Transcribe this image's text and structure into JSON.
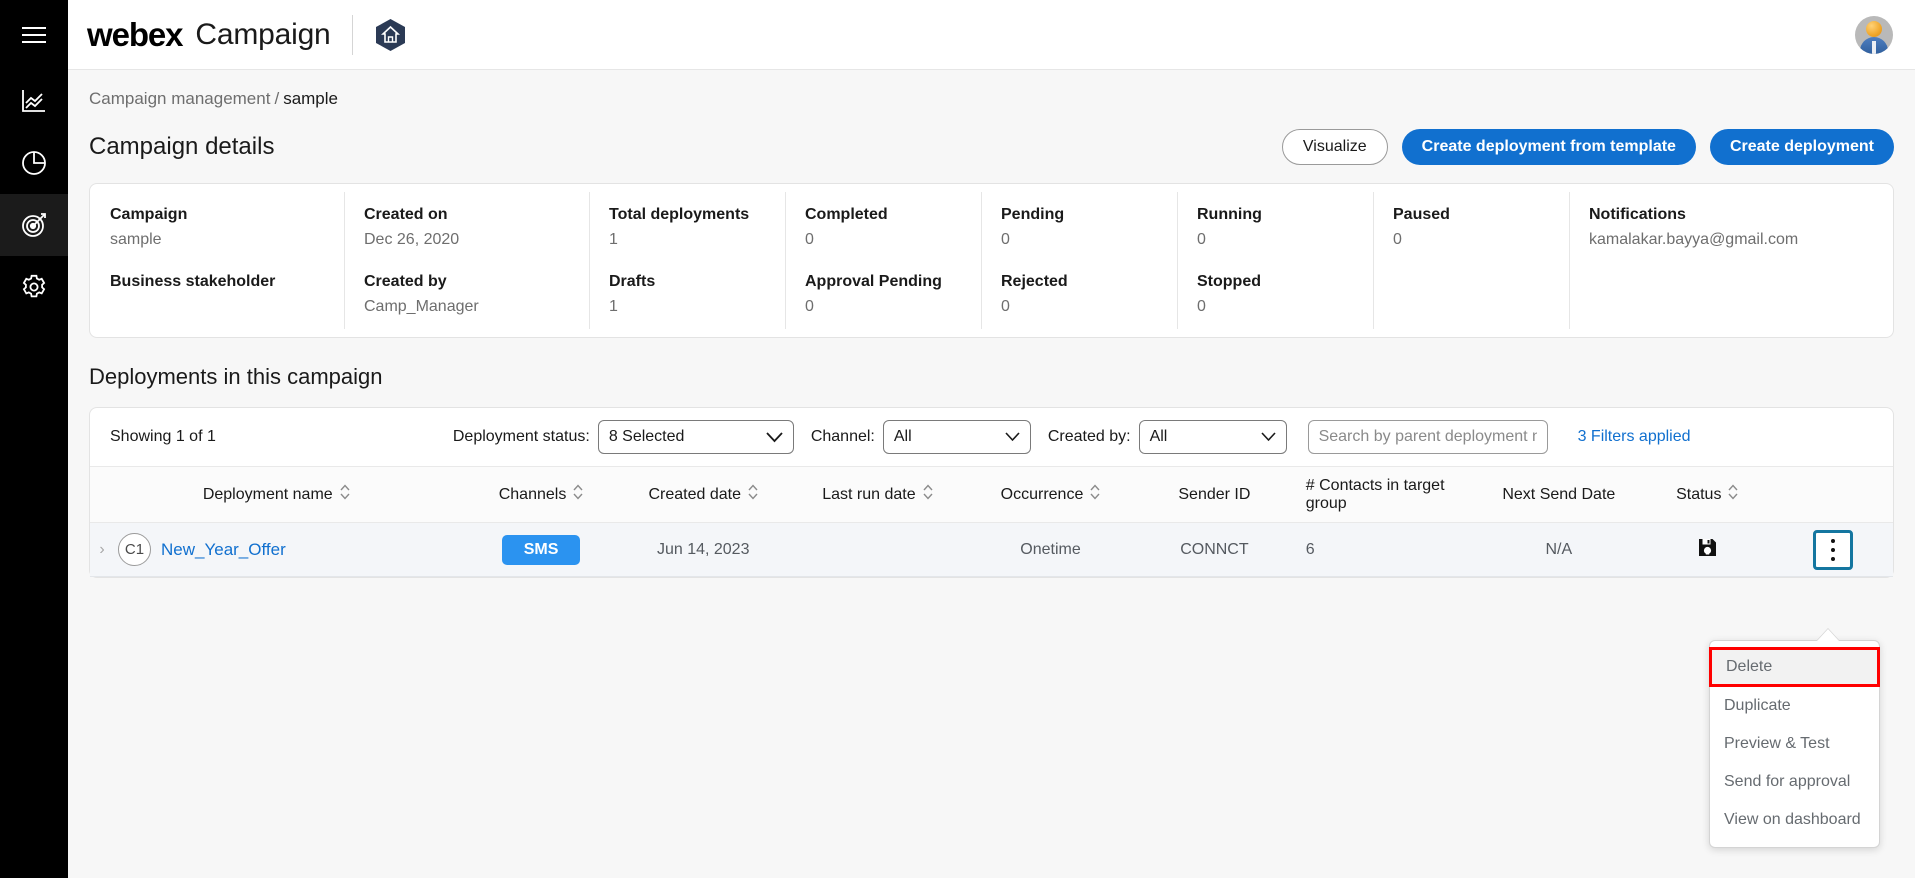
{
  "rail": {
    "items": [
      {
        "name": "menu-icon",
        "label": "Menu"
      },
      {
        "name": "analytics-icon",
        "label": "Analytics"
      },
      {
        "name": "reports-icon",
        "label": "Reports"
      },
      {
        "name": "campaigns-icon",
        "label": "Campaigns"
      },
      {
        "name": "settings-icon",
        "label": "Settings"
      }
    ]
  },
  "topbar": {
    "brand": "webex",
    "product": "Campaign",
    "logo_icon": "app-hexagon-logo",
    "avatar_alt": "User avatar"
  },
  "breadcrumb": {
    "parent": "Campaign management",
    "separator": "/",
    "current": "sample"
  },
  "header": {
    "title": "Campaign details",
    "buttons": {
      "visualize": "Visualize",
      "create_from_template": "Create deployment from template",
      "create_deployment": "Create deployment"
    }
  },
  "details": {
    "columns": [
      {
        "top_label": "Campaign",
        "top_value": "sample",
        "bottom_label": "Business stakeholder",
        "bottom_value": ""
      },
      {
        "top_label": "Created on",
        "top_value": "Dec 26, 2020",
        "bottom_label": "Created by",
        "bottom_value": "Camp_Manager"
      },
      {
        "top_label": "Total deployments",
        "top_value": "1",
        "bottom_label": "Drafts",
        "bottom_value": "1"
      },
      {
        "top_label": "Completed",
        "top_value": "0",
        "bottom_label": "Approval Pending",
        "bottom_value": "0"
      },
      {
        "top_label": "Pending",
        "top_value": "0",
        "bottom_label": "Rejected",
        "bottom_value": "0"
      },
      {
        "top_label": "Running",
        "top_value": "0",
        "bottom_label": "Stopped",
        "bottom_value": "0"
      },
      {
        "top_label": "Paused",
        "top_value": "0",
        "bottom_label": "",
        "bottom_value": ""
      },
      {
        "top_label": "Notifications",
        "top_value": "kamalakar.bayya@gmail.com",
        "bottom_label": "",
        "bottom_value": ""
      }
    ]
  },
  "deployments": {
    "section_title": "Deployments in this campaign",
    "toolbar": {
      "showing": "Showing 1 of 1",
      "status_label": "Deployment status:",
      "status_value": "8 Selected",
      "channel_label": "Channel:",
      "channel_value": "All",
      "created_by_label": "Created by:",
      "created_by_value": "All",
      "search_placeholder": "Search by parent deployment name",
      "search_value": "",
      "filters_applied": "3 Filters applied"
    },
    "columns": [
      {
        "label": "Deployment name",
        "sortable": true
      },
      {
        "label": "Channels",
        "sortable": true
      },
      {
        "label": "Created date",
        "sortable": true
      },
      {
        "label": "Last run date",
        "sortable": true
      },
      {
        "label": "Occurrence",
        "sortable": true
      },
      {
        "label": "Sender ID",
        "sortable": false
      },
      {
        "label": "# Contacts in target group",
        "sortable": false
      },
      {
        "label": "Next Send Date",
        "sortable": false
      },
      {
        "label": "Status",
        "sortable": true
      }
    ],
    "rows": [
      {
        "badge": "C1",
        "name": "New_Year_Offer",
        "channel": "SMS",
        "created_date": "Jun 14, 2023",
        "last_run_date": "",
        "occurrence": "Onetime",
        "sender_id": "CONNCT",
        "contacts": "6",
        "next_send_date": "N/A",
        "status_icon": "save-draft-icon"
      }
    ]
  },
  "action_menu": {
    "items": [
      {
        "label": "Delete",
        "highlighted": true
      },
      {
        "label": "Duplicate",
        "highlighted": false
      },
      {
        "label": "Preview & Test",
        "highlighted": false
      },
      {
        "label": "Send for approval",
        "highlighted": false
      },
      {
        "label": "View on dashboard",
        "highlighted": false
      }
    ]
  },
  "colors": {
    "accent_blue": "#1170cf",
    "chip_blue": "#2b93f0",
    "highlight_red": "#ff0000",
    "focus_teal": "#1476a0"
  }
}
